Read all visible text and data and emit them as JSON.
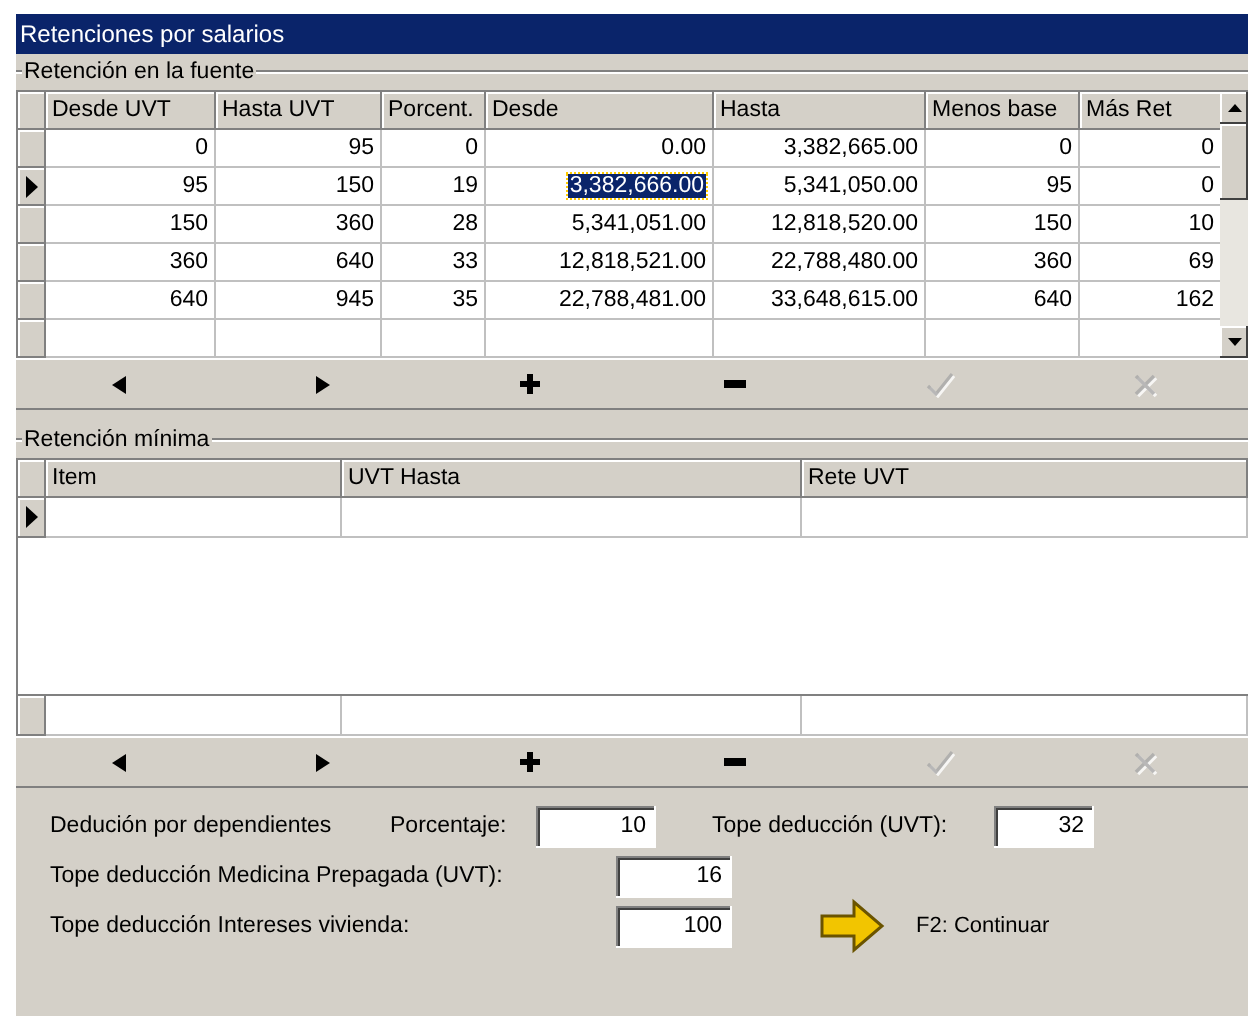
{
  "window": {
    "title": "Retenciones por salarios"
  },
  "retencion_fuente": {
    "title": "Retención en la fuente",
    "columns": [
      {
        "label": "Desde UVT",
        "focused": false
      },
      {
        "label": "Hasta UVT",
        "focused": false
      },
      {
        "label": "Porcent.",
        "focused": false
      },
      {
        "label": "Desde",
        "focused": true
      },
      {
        "label": "Hasta",
        "focused": false
      },
      {
        "label": "Menos base",
        "focused": false
      },
      {
        "label": "Más Ret",
        "focused": false
      }
    ],
    "rows": [
      {
        "selected": false,
        "cells": [
          "0",
          "95",
          "0",
          "0.00",
          "3,382,665.00",
          "0",
          "0"
        ]
      },
      {
        "selected": true,
        "cells": [
          "95",
          "150",
          "19",
          "3,382,666.00",
          "5,341,050.00",
          "95",
          "0"
        ]
      },
      {
        "selected": false,
        "cells": [
          "150",
          "360",
          "28",
          "5,341,051.00",
          "12,818,520.00",
          "150",
          "10"
        ]
      },
      {
        "selected": false,
        "cells": [
          "360",
          "640",
          "33",
          "12,818,521.00",
          "22,788,480.00",
          "360",
          "69"
        ]
      },
      {
        "selected": false,
        "cells": [
          "640",
          "945",
          "35",
          "22,788,481.00",
          "33,648,615.00",
          "640",
          "162"
        ]
      }
    ],
    "navigator": [
      {
        "kind": "prior",
        "disabled": false
      },
      {
        "kind": "next",
        "disabled": false
      },
      {
        "kind": "insert",
        "disabled": false
      },
      {
        "kind": "delete",
        "disabled": false
      },
      {
        "kind": "post",
        "disabled": true
      },
      {
        "kind": "cancel",
        "disabled": true
      }
    ]
  },
  "retencion_minima": {
    "title": "Retención mínima",
    "columns": [
      {
        "label": "Item"
      },
      {
        "label": "UVT Hasta"
      },
      {
        "label": "Rete UVT"
      }
    ],
    "rows": [
      {
        "selected": true
      }
    ],
    "navigator": [
      {
        "kind": "prior",
        "disabled": false
      },
      {
        "kind": "next",
        "disabled": false
      },
      {
        "kind": "insert",
        "disabled": false
      },
      {
        "kind": "delete",
        "disabled": false
      },
      {
        "kind": "post",
        "disabled": true
      },
      {
        "kind": "cancel",
        "disabled": true
      }
    ]
  },
  "deducciones": {
    "dependientes_label": "Dedución por dependientes",
    "porcentaje_label": "Porcentaje:",
    "porcentaje_value": "10",
    "tope_label": "Tope deducción (UVT):",
    "tope_value": "32",
    "medicina_label": "Tope deducción Medicina Prepagada (UVT):",
    "medicina_value": "16",
    "vivienda_label": "Tope deducción Intereses vivienda:",
    "vivienda_value": "100"
  },
  "continue": {
    "label": "F2: Continuar"
  }
}
